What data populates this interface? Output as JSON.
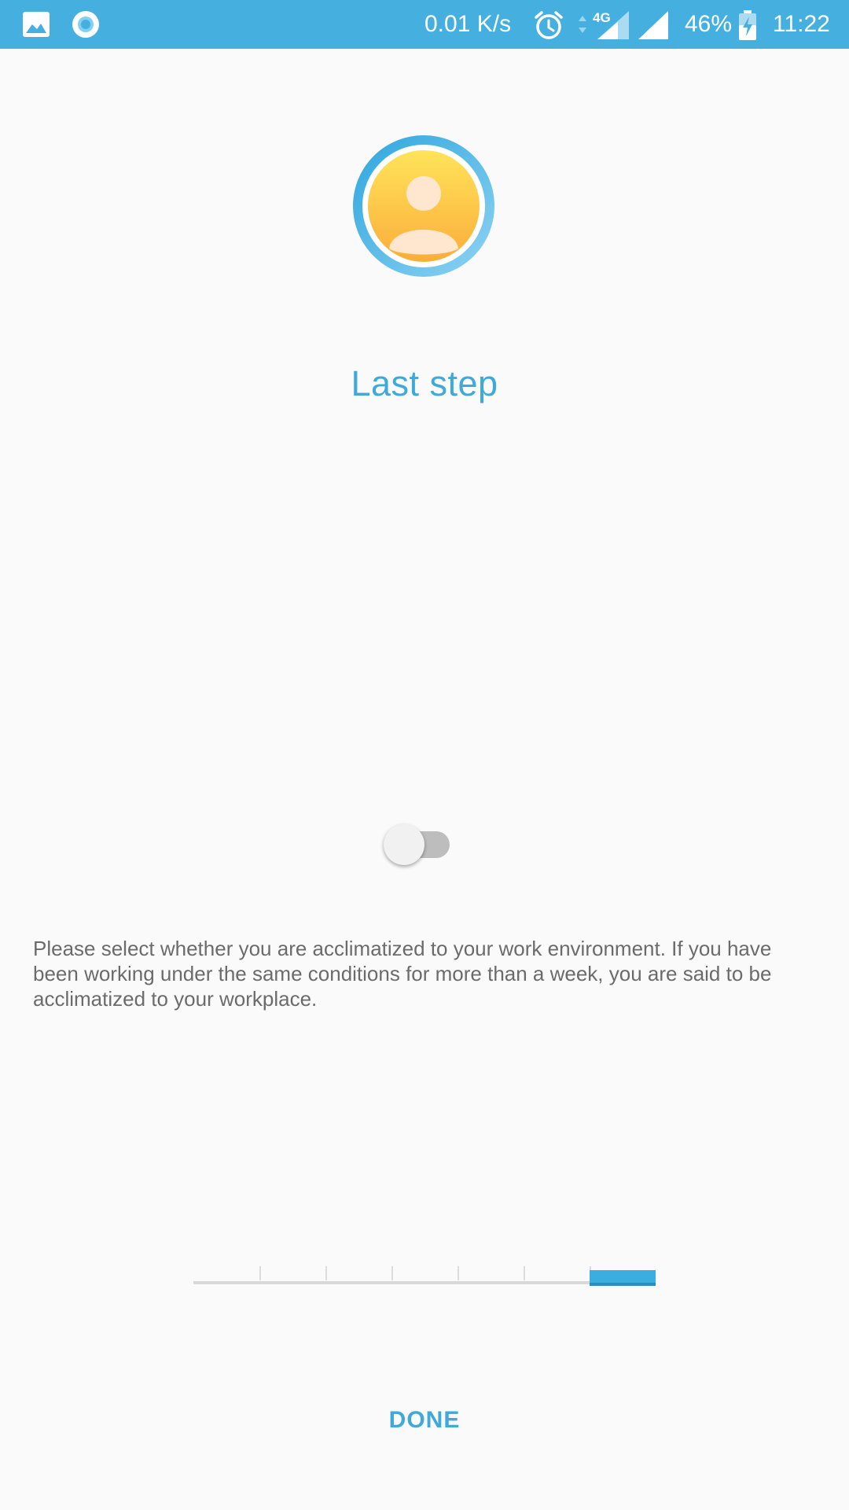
{
  "status_bar": {
    "network_speed": "0.01 K/s",
    "network_type": "4G",
    "battery": "46%",
    "time": "11:22",
    "background_color": "#45b0e0",
    "icons": [
      "gallery-icon",
      "circle-notification-icon",
      "alarm-icon",
      "data-arrows-icon",
      "signal-icon",
      "wifi-signal-icon",
      "battery-charging-icon"
    ]
  },
  "onboarding": {
    "title": "Last step",
    "avatar_icon": "user-avatar-icon",
    "toggle": {
      "state": "off"
    },
    "description": "Please select whether you are acclimatized to your work environment. If you have been working under the same conditions for more than a week, you are said to be acclimatized to your workplace.",
    "progress": {
      "total_steps": 7,
      "current_step": 7
    },
    "done_label": "DONE",
    "accent_color": "#3fa9da"
  }
}
